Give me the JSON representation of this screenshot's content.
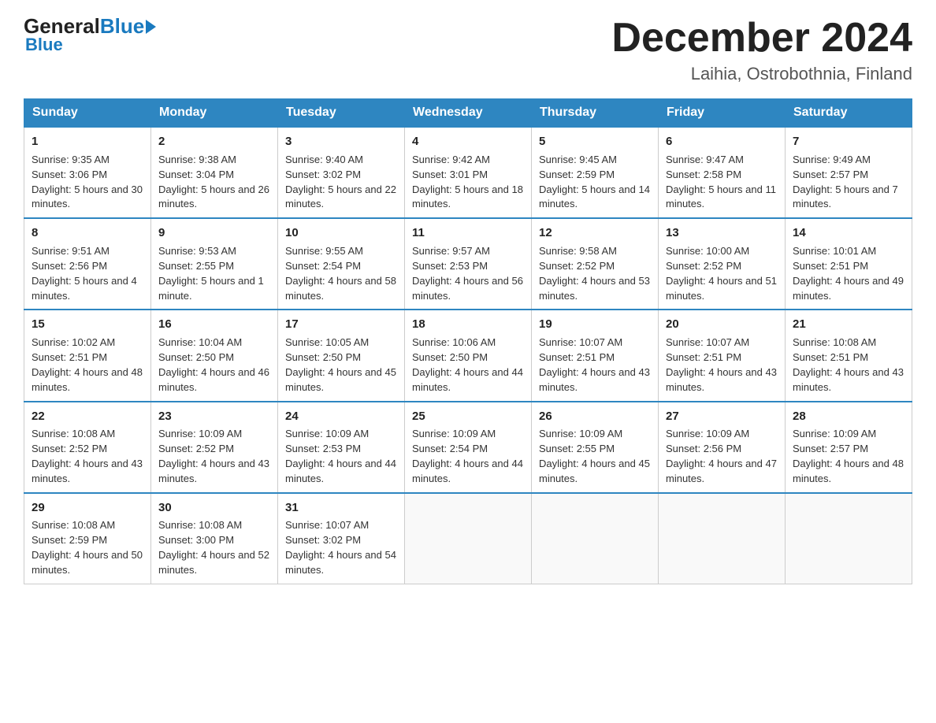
{
  "logo": {
    "general": "General",
    "blue": "Blue",
    "arrow": "►"
  },
  "title": "December 2024",
  "location": "Laihia, Ostrobothnia, Finland",
  "days_of_week": [
    "Sunday",
    "Monday",
    "Tuesday",
    "Wednesday",
    "Thursday",
    "Friday",
    "Saturday"
  ],
  "weeks": [
    [
      {
        "day": "1",
        "sunrise": "9:35 AM",
        "sunset": "3:06 PM",
        "daylight": "5 hours and 30 minutes."
      },
      {
        "day": "2",
        "sunrise": "9:38 AM",
        "sunset": "3:04 PM",
        "daylight": "5 hours and 26 minutes."
      },
      {
        "day": "3",
        "sunrise": "9:40 AM",
        "sunset": "3:02 PM",
        "daylight": "5 hours and 22 minutes."
      },
      {
        "day": "4",
        "sunrise": "9:42 AM",
        "sunset": "3:01 PM",
        "daylight": "5 hours and 18 minutes."
      },
      {
        "day": "5",
        "sunrise": "9:45 AM",
        "sunset": "2:59 PM",
        "daylight": "5 hours and 14 minutes."
      },
      {
        "day": "6",
        "sunrise": "9:47 AM",
        "sunset": "2:58 PM",
        "daylight": "5 hours and 11 minutes."
      },
      {
        "day": "7",
        "sunrise": "9:49 AM",
        "sunset": "2:57 PM",
        "daylight": "5 hours and 7 minutes."
      }
    ],
    [
      {
        "day": "8",
        "sunrise": "9:51 AM",
        "sunset": "2:56 PM",
        "daylight": "5 hours and 4 minutes."
      },
      {
        "day": "9",
        "sunrise": "9:53 AM",
        "sunset": "2:55 PM",
        "daylight": "5 hours and 1 minute."
      },
      {
        "day": "10",
        "sunrise": "9:55 AM",
        "sunset": "2:54 PM",
        "daylight": "4 hours and 58 minutes."
      },
      {
        "day": "11",
        "sunrise": "9:57 AM",
        "sunset": "2:53 PM",
        "daylight": "4 hours and 56 minutes."
      },
      {
        "day": "12",
        "sunrise": "9:58 AM",
        "sunset": "2:52 PM",
        "daylight": "4 hours and 53 minutes."
      },
      {
        "day": "13",
        "sunrise": "10:00 AM",
        "sunset": "2:52 PM",
        "daylight": "4 hours and 51 minutes."
      },
      {
        "day": "14",
        "sunrise": "10:01 AM",
        "sunset": "2:51 PM",
        "daylight": "4 hours and 49 minutes."
      }
    ],
    [
      {
        "day": "15",
        "sunrise": "10:02 AM",
        "sunset": "2:51 PM",
        "daylight": "4 hours and 48 minutes."
      },
      {
        "day": "16",
        "sunrise": "10:04 AM",
        "sunset": "2:50 PM",
        "daylight": "4 hours and 46 minutes."
      },
      {
        "day": "17",
        "sunrise": "10:05 AM",
        "sunset": "2:50 PM",
        "daylight": "4 hours and 45 minutes."
      },
      {
        "day": "18",
        "sunrise": "10:06 AM",
        "sunset": "2:50 PM",
        "daylight": "4 hours and 44 minutes."
      },
      {
        "day": "19",
        "sunrise": "10:07 AM",
        "sunset": "2:51 PM",
        "daylight": "4 hours and 43 minutes."
      },
      {
        "day": "20",
        "sunrise": "10:07 AM",
        "sunset": "2:51 PM",
        "daylight": "4 hours and 43 minutes."
      },
      {
        "day": "21",
        "sunrise": "10:08 AM",
        "sunset": "2:51 PM",
        "daylight": "4 hours and 43 minutes."
      }
    ],
    [
      {
        "day": "22",
        "sunrise": "10:08 AM",
        "sunset": "2:52 PM",
        "daylight": "4 hours and 43 minutes."
      },
      {
        "day": "23",
        "sunrise": "10:09 AM",
        "sunset": "2:52 PM",
        "daylight": "4 hours and 43 minutes."
      },
      {
        "day": "24",
        "sunrise": "10:09 AM",
        "sunset": "2:53 PM",
        "daylight": "4 hours and 44 minutes."
      },
      {
        "day": "25",
        "sunrise": "10:09 AM",
        "sunset": "2:54 PM",
        "daylight": "4 hours and 44 minutes."
      },
      {
        "day": "26",
        "sunrise": "10:09 AM",
        "sunset": "2:55 PM",
        "daylight": "4 hours and 45 minutes."
      },
      {
        "day": "27",
        "sunrise": "10:09 AM",
        "sunset": "2:56 PM",
        "daylight": "4 hours and 47 minutes."
      },
      {
        "day": "28",
        "sunrise": "10:09 AM",
        "sunset": "2:57 PM",
        "daylight": "4 hours and 48 minutes."
      }
    ],
    [
      {
        "day": "29",
        "sunrise": "10:08 AM",
        "sunset": "2:59 PM",
        "daylight": "4 hours and 50 minutes."
      },
      {
        "day": "30",
        "sunrise": "10:08 AM",
        "sunset": "3:00 PM",
        "daylight": "4 hours and 52 minutes."
      },
      {
        "day": "31",
        "sunrise": "10:07 AM",
        "sunset": "3:02 PM",
        "daylight": "4 hours and 54 minutes."
      },
      null,
      null,
      null,
      null
    ]
  ]
}
